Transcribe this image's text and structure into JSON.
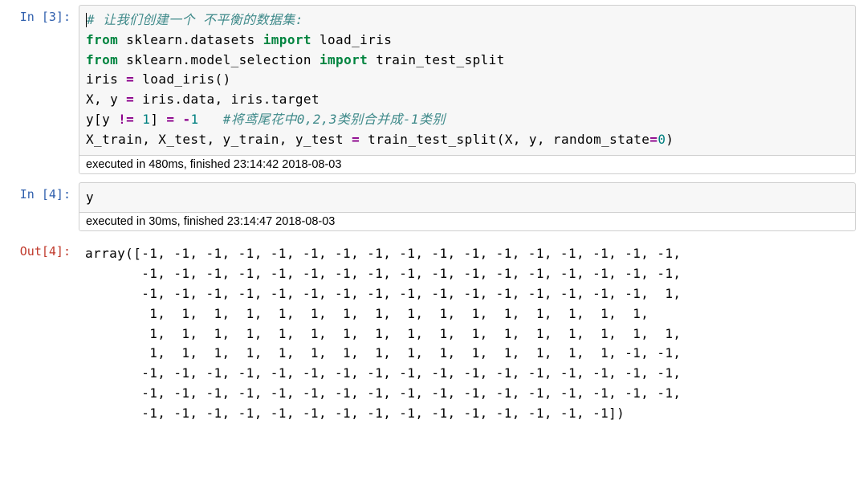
{
  "cells": {
    "c3": {
      "in_prompt": "In  [3]:",
      "code": {
        "l1_comment": "# 让我们创建一个 不平衡的数据集:",
        "l2_kw1": "from",
        "l2_mod": " sklearn.datasets ",
        "l2_kw2": "import",
        "l2_name": " load_iris",
        "l3_kw1": "from",
        "l3_mod": " sklearn.model_selection ",
        "l3_kw2": "import",
        "l3_name": " train_test_split",
        "l4_a": "iris ",
        "l4_eq": "=",
        "l4_b": " load_iris()",
        "l5_a": "X, y ",
        "l5_eq": "=",
        "l5_b": " iris.data, iris.target",
        "l6_a": "y[y ",
        "l6_op": "!=",
        "l6_b": " ",
        "l6_n1": "1",
        "l6_c": "] ",
        "l6_eq": "=",
        "l6_d": " ",
        "l6_neg": "-",
        "l6_n2": "1",
        "l6_sp": "   ",
        "l6_cm": "#将鸢尾花中0,2,3类别合并成-1类别",
        "l7_a": "X_train, X_test, y_train, y_test ",
        "l7_eq": "=",
        "l7_b": " train_test_split(X, y, random_state",
        "l7_eq2": "=",
        "l7_n": "0",
        "l7_c": ")"
      },
      "timing": "executed in 480ms, finished 23:14:42 2018-08-03"
    },
    "c4": {
      "in_prompt": "In  [4]:",
      "code_text": "y",
      "timing": "executed in 30ms, finished 23:14:47 2018-08-03",
      "out_prompt": "Out[4]:",
      "output_text": "array([-1, -1, -1, -1, -1, -1, -1, -1, -1, -1, -1, -1, -1, -1, -1, -1, -1,\n       -1, -1, -1, -1, -1, -1, -1, -1, -1, -1, -1, -1, -1, -1, -1, -1, -1,\n       -1, -1, -1, -1, -1, -1, -1, -1, -1, -1, -1, -1, -1, -1, -1, -1,  1,\n        1,  1,  1,  1,  1,  1,  1,  1,  1,  1,  1,  1,  1,  1,  1,  1,\n        1,  1,  1,  1,  1,  1,  1,  1,  1,  1,  1,  1,  1,  1,  1,  1,  1,\n        1,  1,  1,  1,  1,  1,  1,  1,  1,  1,  1,  1,  1,  1,  1, -1, -1,\n       -1, -1, -1, -1, -1, -1, -1, -1, -1, -1, -1, -1, -1, -1, -1, -1, -1,\n       -1, -1, -1, -1, -1, -1, -1, -1, -1, -1, -1, -1, -1, -1, -1, -1, -1,\n       -1, -1, -1, -1, -1, -1, -1, -1, -1, -1, -1, -1, -1, -1, -1])"
    }
  }
}
